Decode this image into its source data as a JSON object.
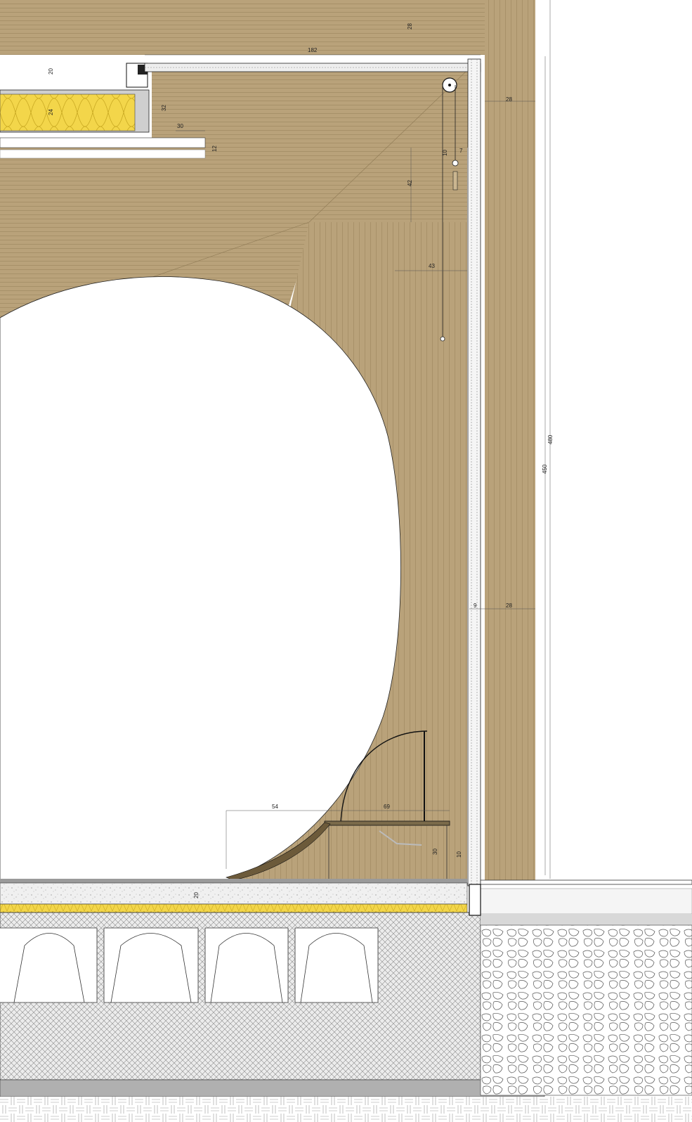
{
  "colors": {
    "wood": "#b9a27a",
    "wood_line": "#8f7a55",
    "insulation": "#f0d44a",
    "concrete": "#e6e6e6",
    "gravel": "#ffffff",
    "hatch": "#9a9a9a",
    "slab": "#b0b0b0",
    "line": "#1a1a1a"
  },
  "dimensions": {
    "d28_top": "28",
    "d182": "182",
    "d20_top": "20",
    "d24": "24",
    "d32": "32",
    "d30_top": "30",
    "d12": "12",
    "d28_right_top": "28",
    "d10": "10",
    "d7": "7",
    "d42": "42",
    "d43": "43",
    "d480": "480",
    "d450": "450",
    "d9": "9",
    "d28_right_mid": "28",
    "d54": "54",
    "d69": "69",
    "d30_bottom": "30",
    "d10_bottom": "10",
    "d20_floor": "20"
  }
}
